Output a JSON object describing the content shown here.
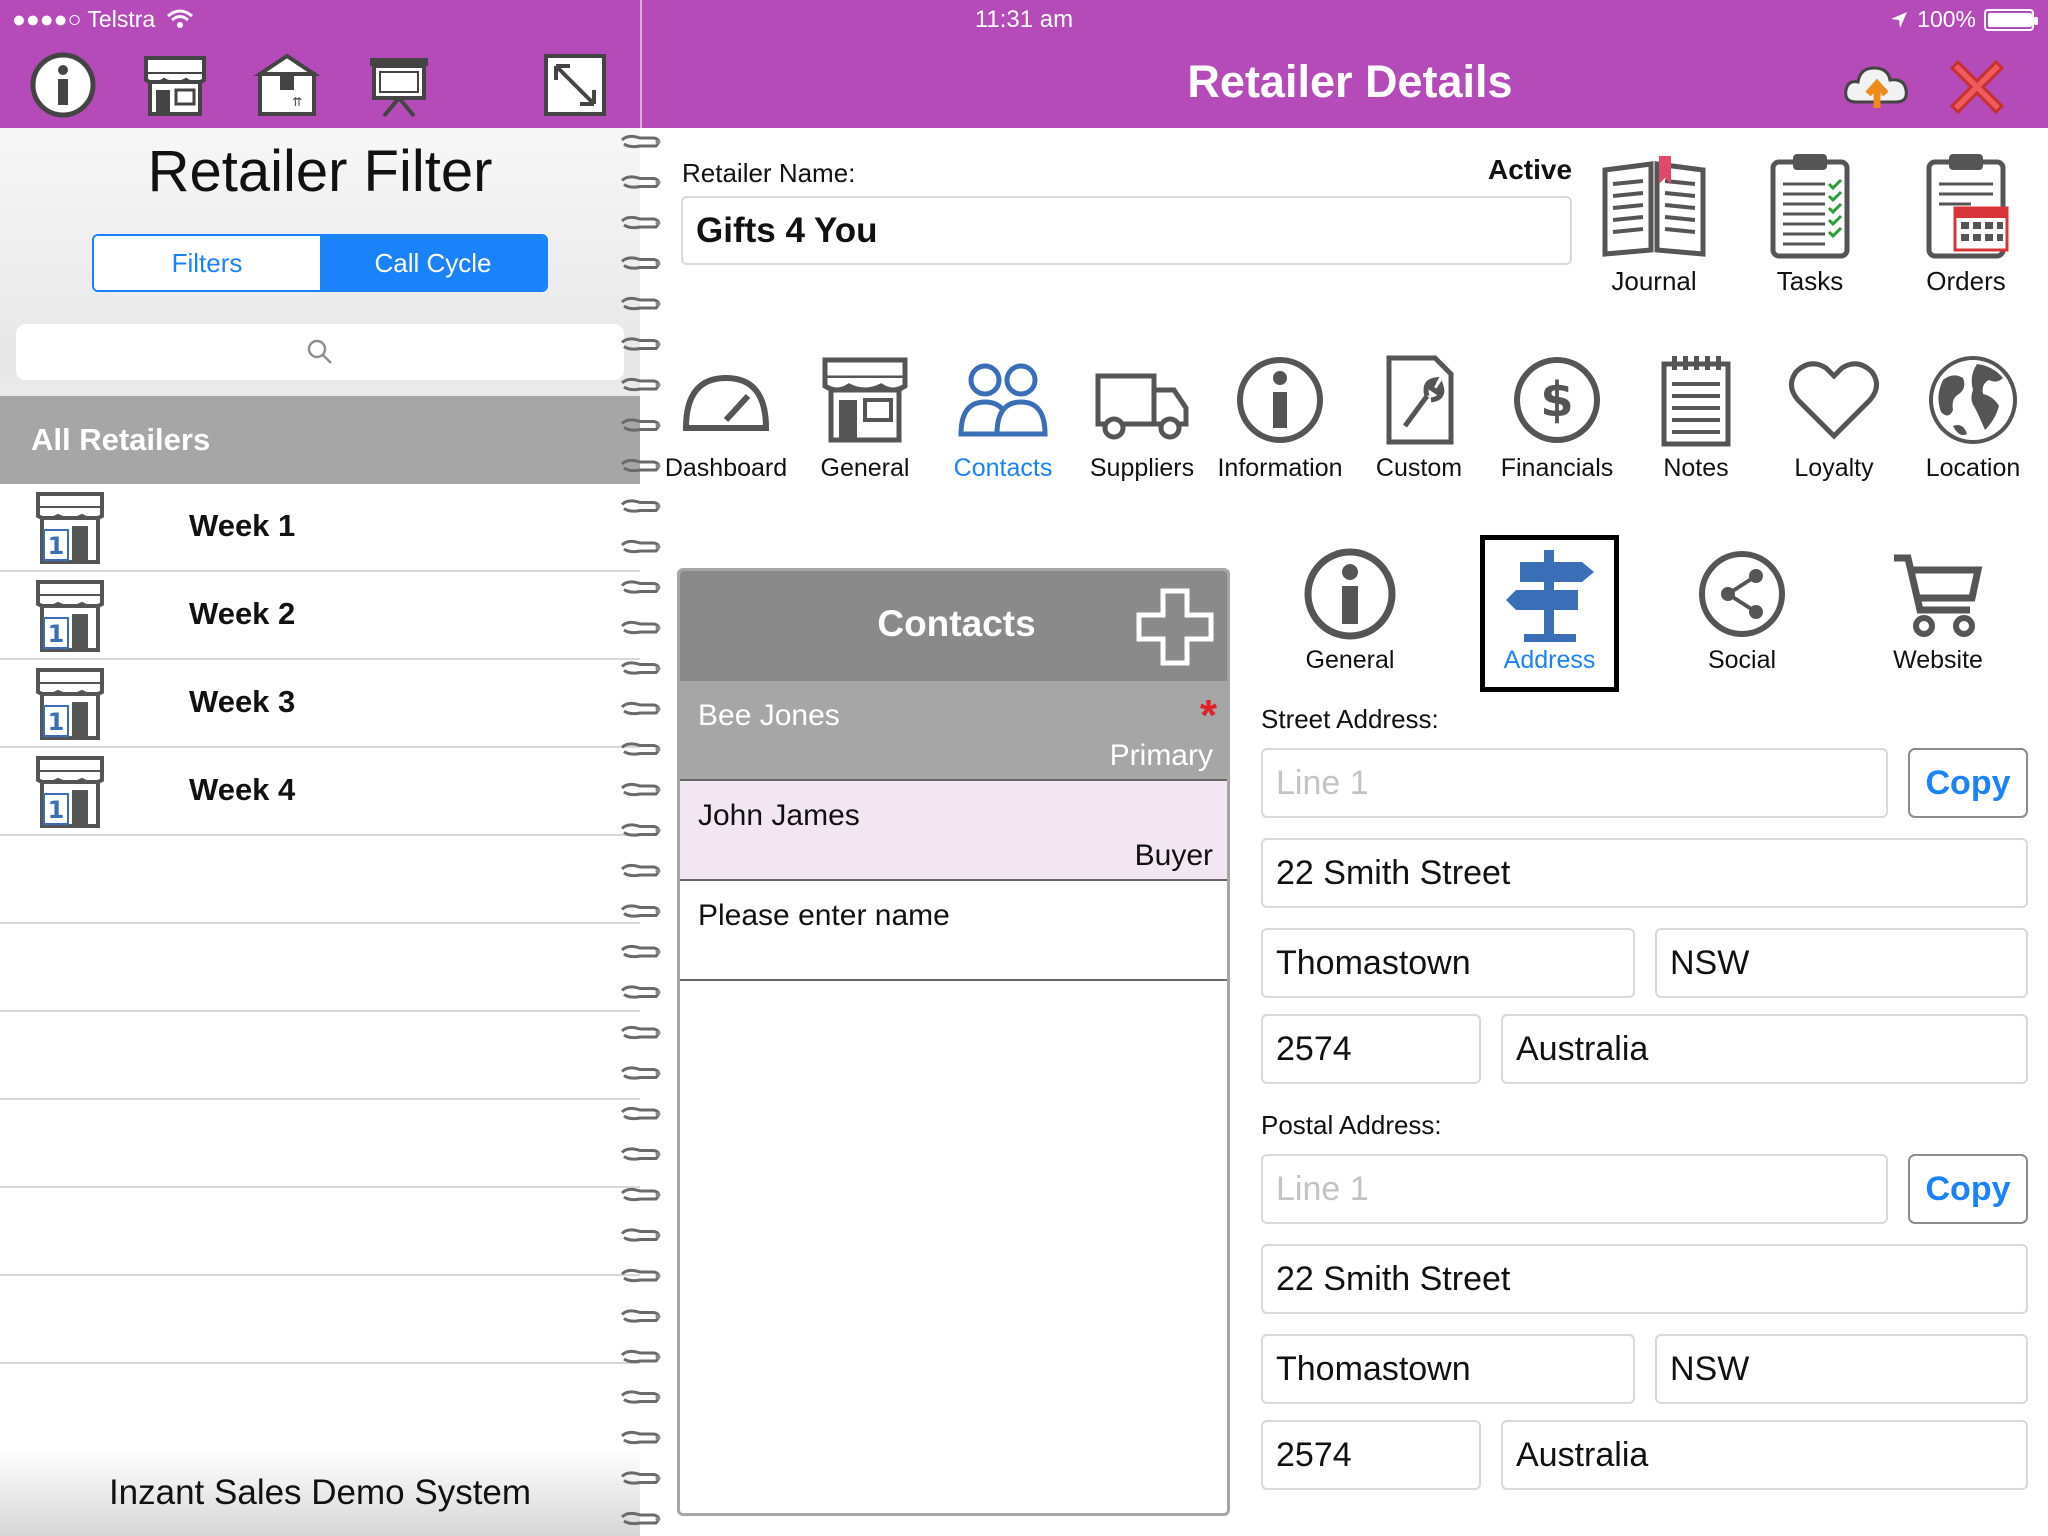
{
  "status_bar": {
    "carrier": "●●●●○ Telstra",
    "time": "11:31 am",
    "battery": "100%",
    "battery_level": 1.0
  },
  "header": {
    "title": "Retailer Details"
  },
  "left_panel": {
    "title": "Retailer Filter",
    "segments": [
      "Filters",
      "Call Cycle"
    ],
    "selected_segment": "Call Cycle",
    "search_placeholder": "",
    "section_header": "All Retailers",
    "items": [
      {
        "label": "Week 1",
        "badge": "1"
      },
      {
        "label": "Week 2",
        "badge": "1"
      },
      {
        "label": "Week 3",
        "badge": "1"
      },
      {
        "label": "Week 4",
        "badge": "1"
      }
    ],
    "footer": "Inzant Sales Demo System"
  },
  "retailer": {
    "name_label": "Retailer Name:",
    "name_value": "Gifts 4 You",
    "status": "Active"
  },
  "top_buttons": {
    "journal": "Journal",
    "tasks": "Tasks",
    "orders": "Orders"
  },
  "nav_tabs": {
    "dashboard": "Dashboard",
    "general": "General",
    "contacts": "Contacts",
    "suppliers": "Suppliers",
    "information": "Information",
    "custom": "Custom",
    "financials": "Financials",
    "notes": "Notes",
    "loyalty": "Loyalty",
    "location": "Location",
    "active": "Contacts"
  },
  "contacts": {
    "title": "Contacts",
    "list": [
      {
        "name": "Bee Jones",
        "role": "Primary",
        "flag": "*"
      },
      {
        "name": "John James",
        "role": "Buyer"
      },
      {
        "name": "Please enter name",
        "role": ""
      }
    ]
  },
  "sub_tabs": {
    "general": "General",
    "address": "Address",
    "social": "Social",
    "website": "Website",
    "active": "Address"
  },
  "street_address": {
    "label": "Street Address:",
    "line1_placeholder": "Line 1",
    "line2": "22 Smith Street",
    "city": "Thomastown",
    "state": "NSW",
    "postcode": "2574",
    "country": "Australia",
    "copy_label": "Copy"
  },
  "postal_address": {
    "label": "Postal Address:",
    "line1_placeholder": "Line 1",
    "line2": "22 Smith Street",
    "city": "Thomastown",
    "state": "NSW",
    "postcode": "2574",
    "country": "Australia",
    "copy_label": "Copy"
  },
  "colors": {
    "header_purple": "#b54bb9",
    "accent_blue": "#1a82fb",
    "icon_gray": "#5c5c5c",
    "active_icon_blue": "#3a6fb8",
    "star_red": "#e0202a"
  }
}
